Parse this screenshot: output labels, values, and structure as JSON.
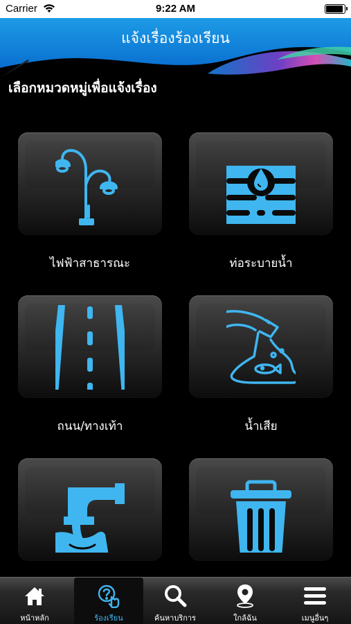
{
  "status_bar": {
    "carrier": "Carrier",
    "time": "9:22 AM"
  },
  "header": {
    "title": "แจ้งเรื่องร้องเรียน"
  },
  "section_title": "เลือกหมวดหมู่เพื่อแจ้งเรื่อง",
  "categories": [
    {
      "label": "ไฟฟ้าสาธารณะ",
      "icon": "street-lamp-icon"
    },
    {
      "label": "ท่อระบายน้ำ",
      "icon": "drain-icon"
    },
    {
      "label": "ถนน/ทางเท้า",
      "icon": "road-icon"
    },
    {
      "label": "น้ำเสีย",
      "icon": "wastewater-icon"
    },
    {
      "label": "",
      "icon": "pipe-discharge-icon"
    },
    {
      "label": "",
      "icon": "trash-icon"
    }
  ],
  "tabs": [
    {
      "label": "หน้าหลัก",
      "icon": "home-icon",
      "active": false
    },
    {
      "label": "ร้องเรียน",
      "icon": "complaint-icon",
      "active": true
    },
    {
      "label": "ค้นหาบริการ",
      "icon": "search-icon",
      "active": false
    },
    {
      "label": "ใกล้ฉัน",
      "icon": "location-pin-icon",
      "active": false
    },
    {
      "label": "เมนูอื่นๆ",
      "icon": "menu-icon",
      "active": false
    }
  ],
  "colors": {
    "accent": "#3fb6f0",
    "icon": "#3fb6f0",
    "background": "#000000"
  }
}
